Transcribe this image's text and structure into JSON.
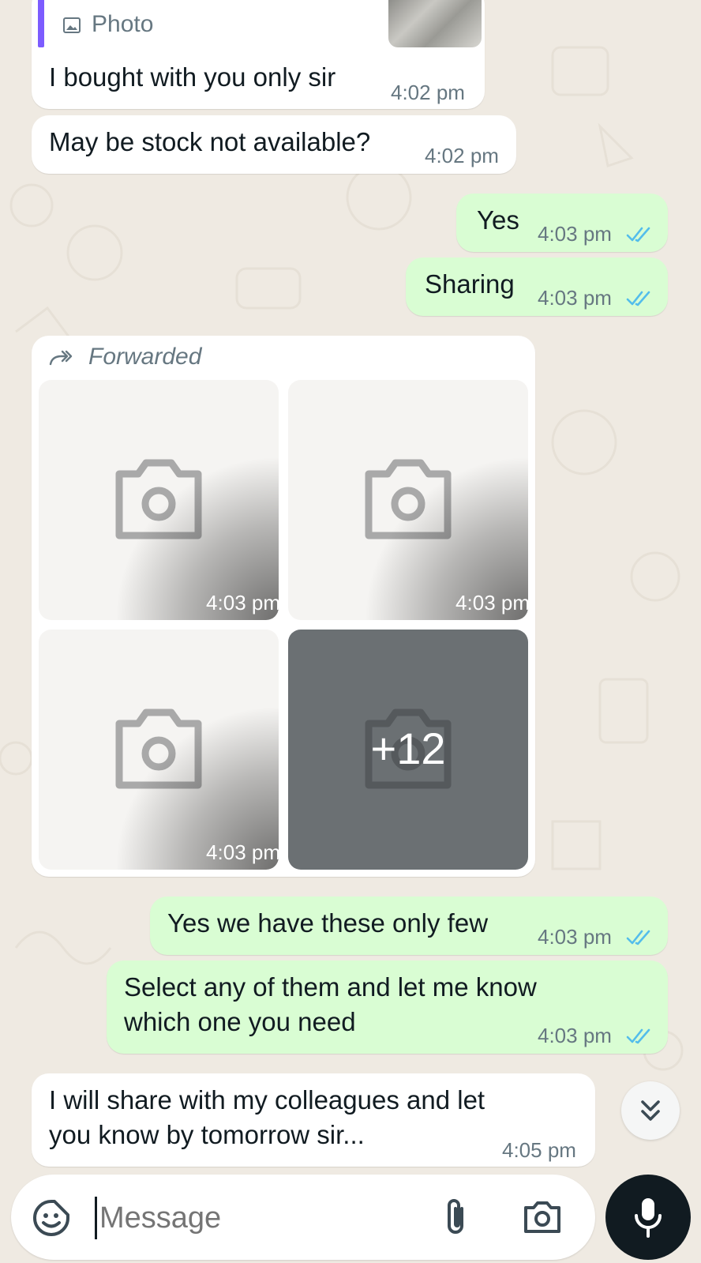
{
  "messages": {
    "quoted": {
      "type_label": "Photo",
      "text": "I bought with you only sir",
      "time": "4:02 pm"
    },
    "stock": {
      "text": "May be stock not available?",
      "time": "4:02 pm"
    },
    "yes": {
      "text": "Yes",
      "time": "4:03 pm"
    },
    "sharing": {
      "text": "Sharing",
      "time": "4:03 pm"
    },
    "forwarded_album": {
      "forwarded_label": "Forwarded",
      "photo_times": [
        "4:03 pm",
        "4:03 pm",
        "4:03 pm"
      ],
      "more_count": "+12"
    },
    "few": {
      "text": "Yes we have these only few",
      "time": "4:03 pm"
    },
    "select": {
      "text": "Select any of them and let me know\nwhich one you need",
      "time": "4:03 pm"
    },
    "share": {
      "text": "I will share with my colleagues and let\nyou know by tomorrow sir...",
      "time": "4:05 pm"
    }
  },
  "composer": {
    "placeholder": "Message"
  },
  "colors": {
    "chat_background": "#efeae2",
    "incoming_bubble": "#ffffff",
    "outgoing_bubble": "#d9fdd3",
    "read_ticks": "#53bdeb",
    "quote_accent": "#7c5cff",
    "mic_button": "#111b21"
  },
  "icons": [
    "photo-icon",
    "double-check-icon",
    "forward-icon",
    "camera-icon",
    "chevrons-down-icon",
    "sticker-icon",
    "attach-icon",
    "mic-icon"
  ]
}
